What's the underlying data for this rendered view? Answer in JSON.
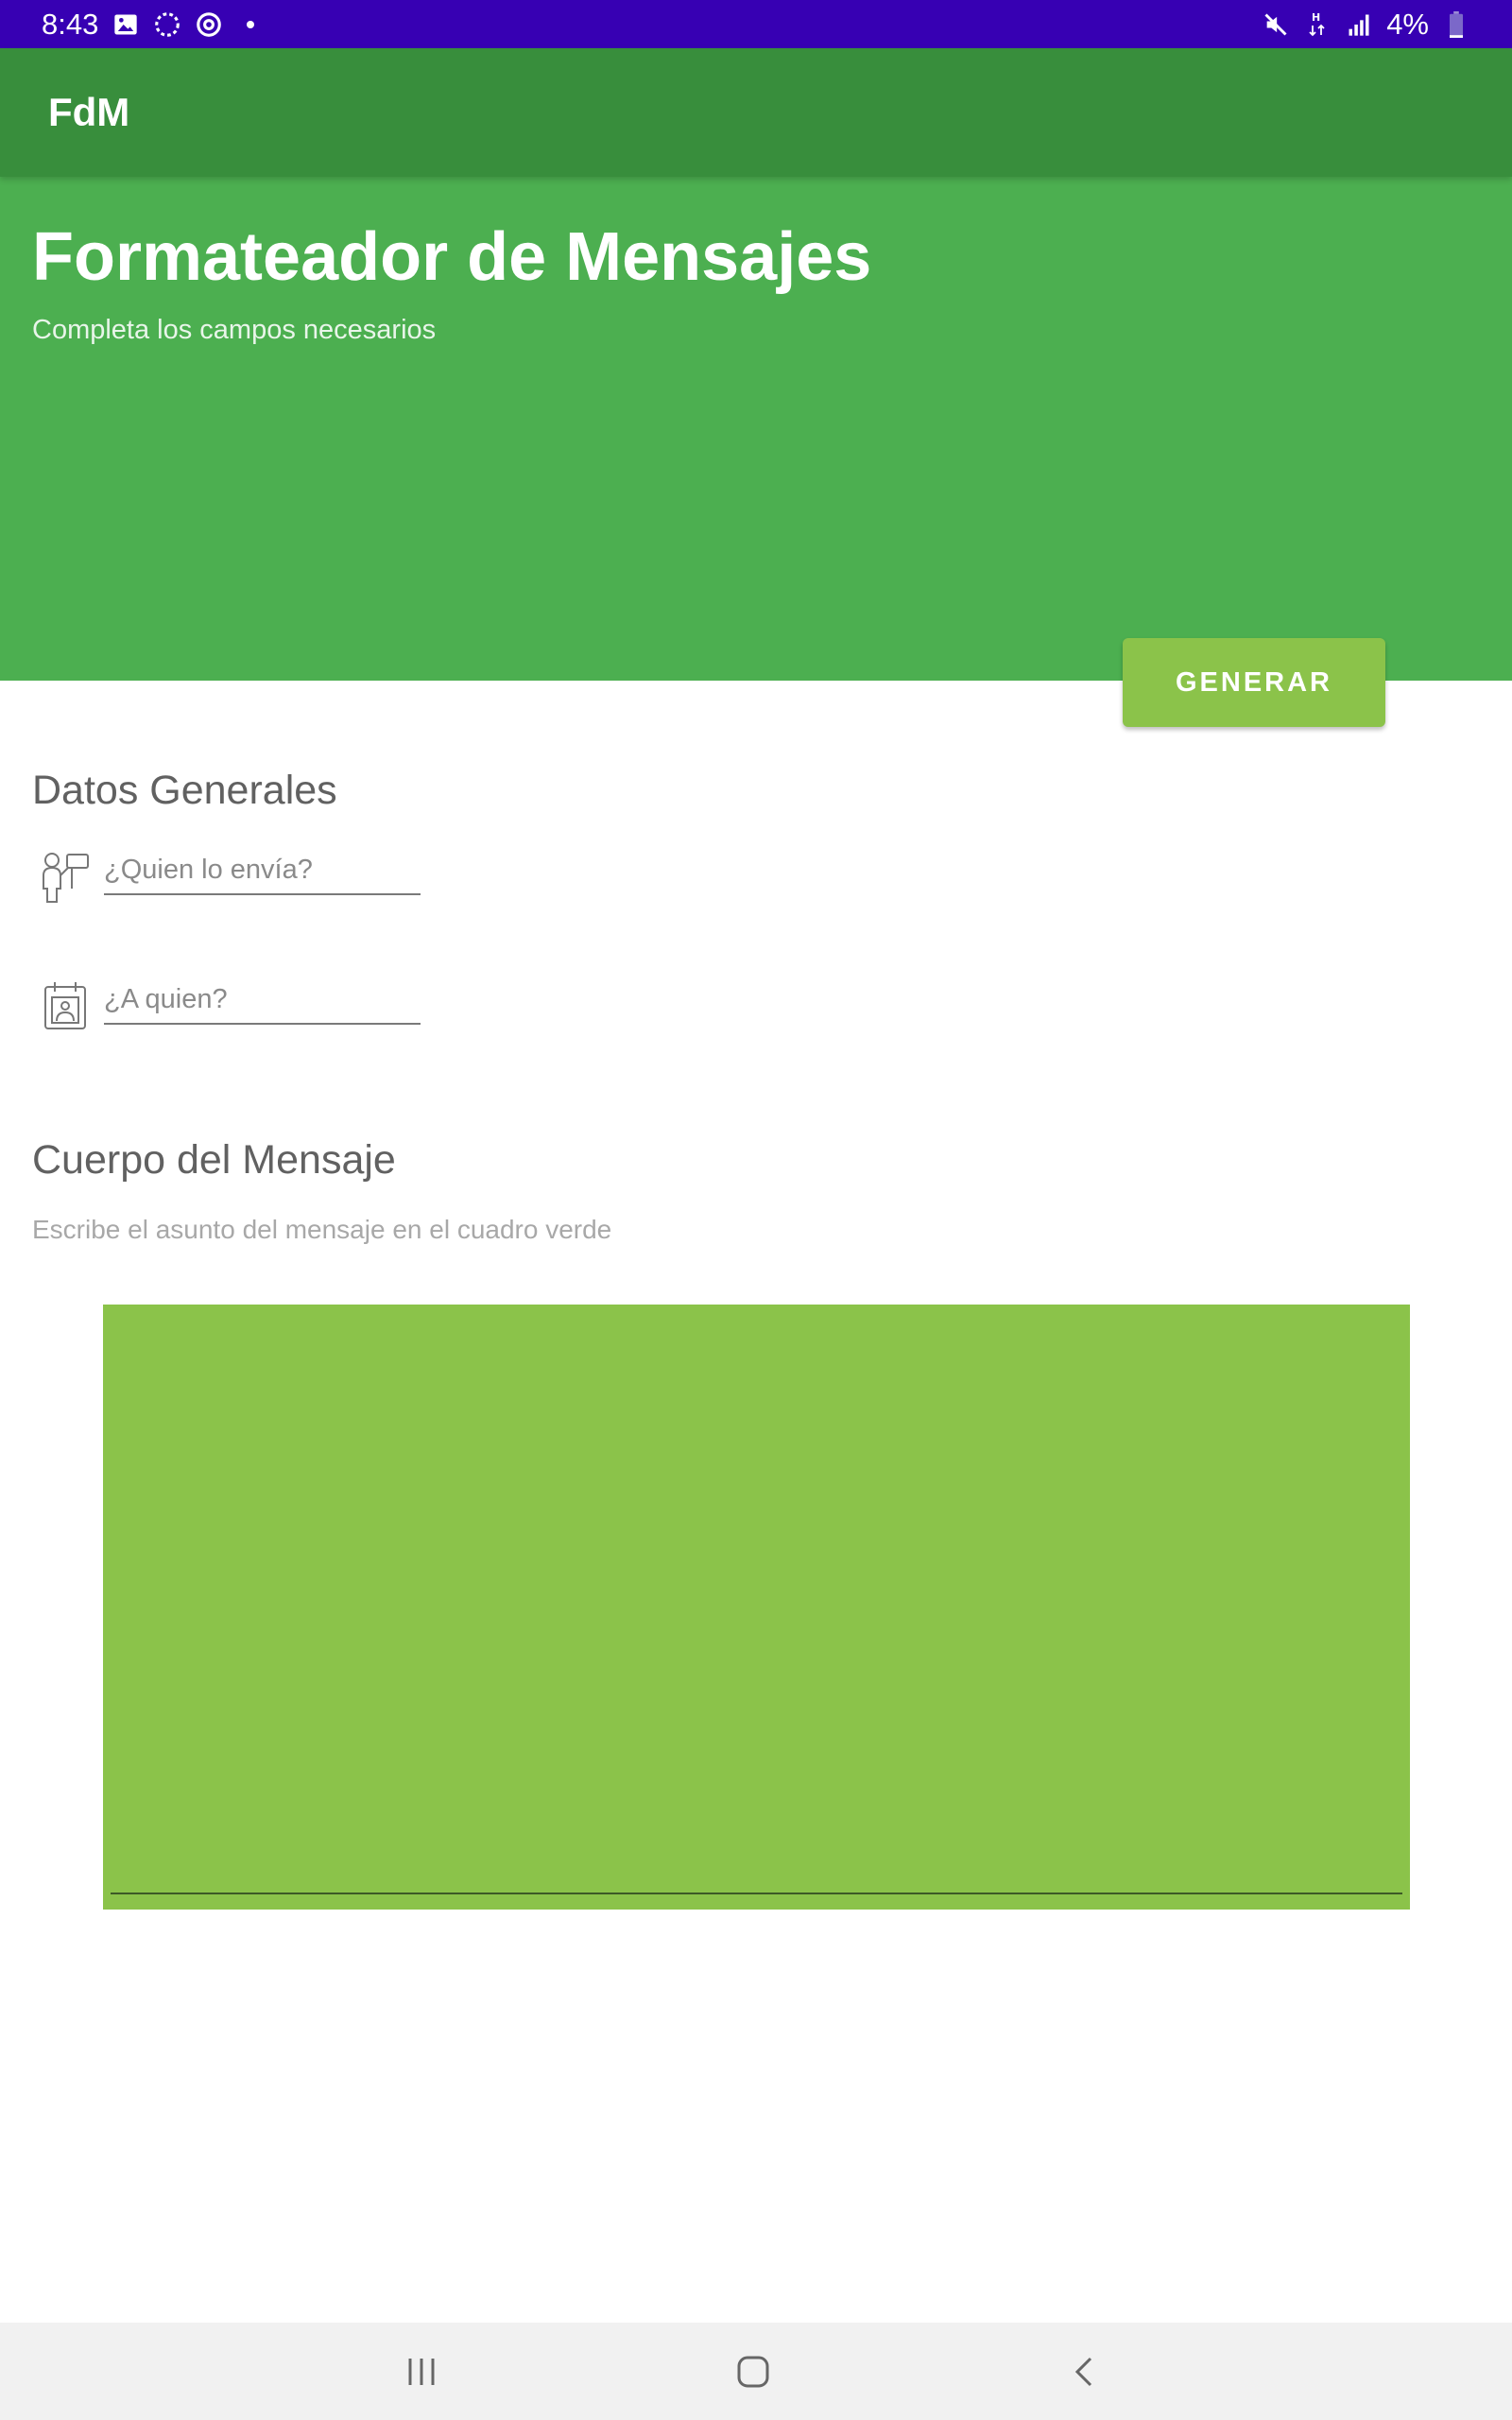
{
  "status_bar": {
    "time": "8:43",
    "battery": "4%",
    "icons": [
      "image-icon",
      "sync-icon",
      "at-sign-icon",
      "dot-icon",
      "mute-icon",
      "h-data-icon",
      "signal-icon",
      "battery-icon"
    ]
  },
  "app_bar": {
    "title": "FdM"
  },
  "header": {
    "title": "Formateador de Mensajes",
    "subtitle": "Completa los campos necesarios"
  },
  "actions": {
    "generar_label": "GENERAR"
  },
  "datos_generales": {
    "title": "Datos Generales",
    "fields": [
      {
        "placeholder": "¿Quien lo envía?",
        "value": "",
        "icon": "person-sign-icon"
      },
      {
        "placeholder": "¿A quien?",
        "value": "",
        "icon": "calendar-contact-icon"
      }
    ]
  },
  "cuerpo": {
    "title": "Cuerpo del Mensaje",
    "hint": "Escribe el asunto del mensaje en el cuadro verde",
    "body_value": ""
  },
  "nav_bar": {
    "buttons": [
      "recent-apps-icon",
      "home-icon",
      "back-icon"
    ]
  },
  "colors": {
    "status_bar": "#3700B3",
    "app_bar": "#388E3C",
    "header": "#4CAF50",
    "accent": "#8BC34A",
    "nav_bar": "#F1F1F1"
  }
}
